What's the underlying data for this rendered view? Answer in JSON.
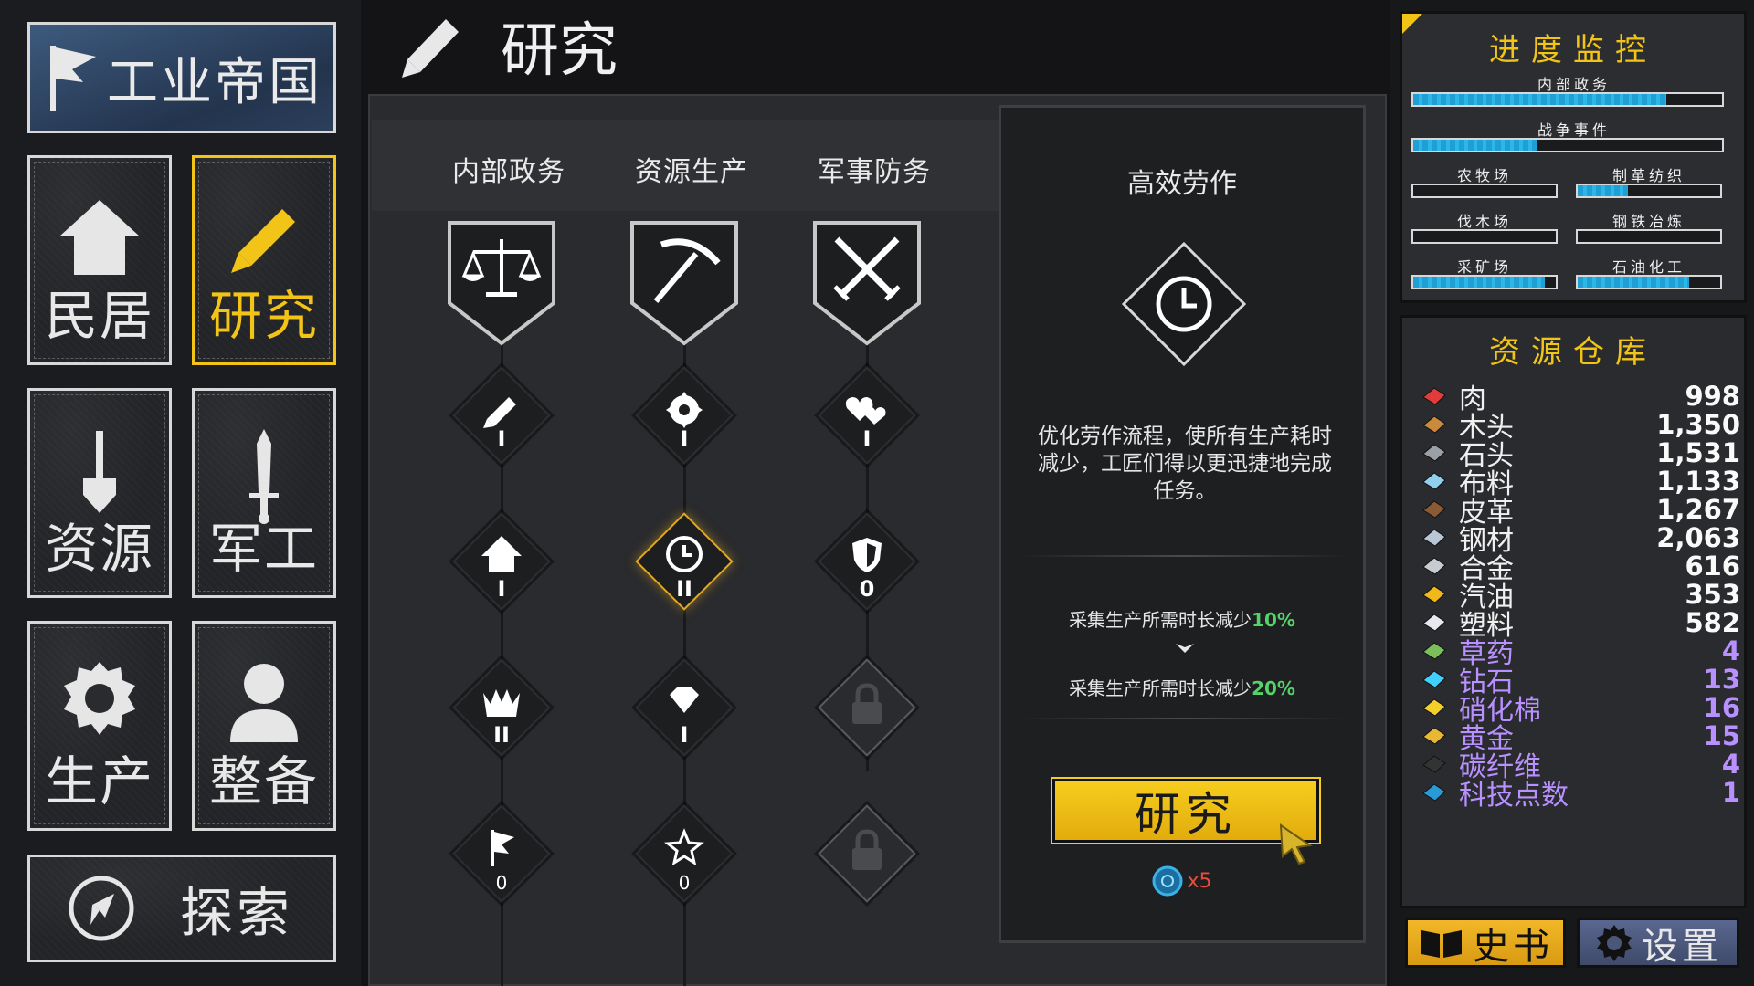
{
  "nav": {
    "title": "工业帝国",
    "homes": "民居",
    "research": "研究",
    "resources": "资源",
    "military": "军工",
    "production": "生产",
    "equipment": "整备",
    "explore": "探索"
  },
  "header": {
    "title": "研究"
  },
  "tabs": [
    "内部政务",
    "资源生产",
    "军事防务"
  ],
  "nodes": {
    "col1": [
      {
        "icon": "pencil-icon",
        "level": "I"
      },
      {
        "icon": "house-icon",
        "level": "I"
      },
      {
        "icon": "crown-icon",
        "level": "II"
      },
      {
        "icon": "flag-icon",
        "level": "0"
      }
    ],
    "col2": [
      {
        "icon": "gear-icon",
        "level": "I"
      },
      {
        "icon": "clock-icon",
        "level": "II"
      },
      {
        "icon": "diamond-icon",
        "level": "I"
      },
      {
        "icon": "star-icon",
        "level": "0"
      }
    ],
    "col3": [
      {
        "icon": "hearts-icon",
        "level": "I"
      },
      {
        "icon": "shield-icon",
        "level": "0"
      },
      {
        "icon": "lock-icon",
        "level": ""
      },
      {
        "icon": "lock-icon",
        "level": ""
      }
    ]
  },
  "detail": {
    "name": "高效劳作",
    "description": "优化劳作流程，使所有生产耗时减少，工匠们得以更迅捷地完成任务。",
    "effect_current_text": "采集生产所需时长减少",
    "effect_current_pct": "10%",
    "effect_next_text": "采集生产所需时长减少",
    "effect_next_pct": "20%",
    "button": "研究",
    "cost": "x5"
  },
  "progress": {
    "title": "进度监控",
    "bars": [
      {
        "label": "内部政务",
        "value": 0.82
      },
      {
        "label": "战争事件",
        "value": 0.4
      },
      {
        "label": "农牧场",
        "value": 0.0
      },
      {
        "label": "制革纺织",
        "value": 0.35
      },
      {
        "label": "伐木场",
        "value": 0.0
      },
      {
        "label": "钢铁冶炼",
        "value": 0.0
      },
      {
        "label": "采矿场",
        "value": 0.92
      },
      {
        "label": "石油化工",
        "value": 0.78
      }
    ]
  },
  "warehouse": {
    "title": "资源仓库",
    "items": [
      {
        "name": "肉",
        "value": "998",
        "rare": false,
        "color": "#e23b3b"
      },
      {
        "name": "木头",
        "value": "1,350",
        "rare": false,
        "color": "#c98a3c"
      },
      {
        "name": "石头",
        "value": "1,531",
        "rare": false,
        "color": "#9aa0a6"
      },
      {
        "name": "布料",
        "value": "1,133",
        "rare": false,
        "color": "#8fd0ee"
      },
      {
        "name": "皮革",
        "value": "1,267",
        "rare": false,
        "color": "#8a5a34"
      },
      {
        "name": "钢材",
        "value": "2,063",
        "rare": false,
        "color": "#b8c6d6"
      },
      {
        "name": "合金",
        "value": "616",
        "rare": false,
        "color": "#c7ccd2"
      },
      {
        "name": "汽油",
        "value": "353",
        "rare": false,
        "color": "#f0b81a"
      },
      {
        "name": "塑料",
        "value": "582",
        "rare": false,
        "color": "#e8e8f0"
      },
      {
        "name": "草药",
        "value": "4",
        "rare": true,
        "color": "#7bbf5a"
      },
      {
        "name": "钻石",
        "value": "13",
        "rare": true,
        "color": "#40d0ff"
      },
      {
        "name": "硝化棉",
        "value": "16",
        "rare": true,
        "color": "#f3cf2a"
      },
      {
        "name": "黄金",
        "value": "15",
        "rare": true,
        "color": "#e9b833"
      },
      {
        "name": "碳纤维",
        "value": "4",
        "rare": true,
        "color": "#333333"
      },
      {
        "name": "科技点数",
        "value": "1",
        "rare": true,
        "color": "#2a9ad6"
      }
    ]
  },
  "bottom": {
    "history": "史书",
    "settings": "设置"
  },
  "colors": {
    "accent": "#f2c418",
    "rare": "#b990ff",
    "bar": "#1f9fd4"
  }
}
